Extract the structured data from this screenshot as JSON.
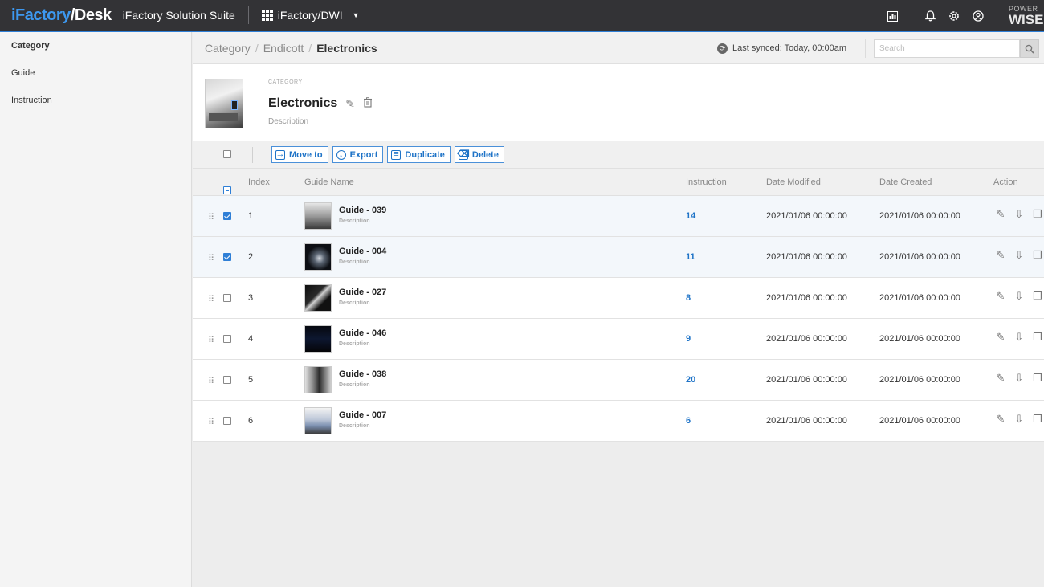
{
  "topbar": {
    "logo_part1": "iFactory",
    "logo_part2": "/Desk",
    "suite": "iFactory Solution Suite",
    "app_switcher": "iFactory/DWI",
    "brand_line1": "POWER",
    "brand_line2": "WISE",
    "icons": [
      "report-icon",
      "bell-icon",
      "gear-icon",
      "user-icon"
    ]
  },
  "sidebar": {
    "items": [
      {
        "label": "Category",
        "active": true
      },
      {
        "label": "Guide",
        "active": false
      },
      {
        "label": "Instruction",
        "active": false
      }
    ]
  },
  "breadcrumb": {
    "items": [
      "Category",
      "Endicott",
      "Electronics"
    ],
    "separator": "/"
  },
  "sync": {
    "text": "Last synced: Today, 00:00am"
  },
  "search": {
    "placeholder": "Search"
  },
  "category": {
    "label": "CATEGORY",
    "title": "Electronics",
    "description": "Description"
  },
  "toolbar": {
    "move_label": "Move to",
    "export_label": "Export",
    "duplicate_label": "Duplicate",
    "delete_label": "Delete"
  },
  "table": {
    "columns": {
      "index": "Index",
      "name": "Guide Name",
      "instruction": "Instruction",
      "modified": "Date Modified",
      "created": "Date Created",
      "action": "Action"
    },
    "rows": [
      {
        "index": "1",
        "name": "Guide - 039",
        "desc": "Description",
        "instruction": "14",
        "modified": "2021/01/06 00:00:00",
        "created": "2021/01/06 00:00:00",
        "checked": true
      },
      {
        "index": "2",
        "name": "Guide - 004",
        "desc": "Description",
        "instruction": "11",
        "modified": "2021/01/06 00:00:00",
        "created": "2021/01/06 00:00:00",
        "checked": true
      },
      {
        "index": "3",
        "name": "Guide - 027",
        "desc": "Description",
        "instruction": "8",
        "modified": "2021/01/06 00:00:00",
        "created": "2021/01/06 00:00:00",
        "checked": false
      },
      {
        "index": "4",
        "name": "Guide - 046",
        "desc": "Description",
        "instruction": "9",
        "modified": "2021/01/06 00:00:00",
        "created": "2021/01/06 00:00:00",
        "checked": false
      },
      {
        "index": "5",
        "name": "Guide - 038",
        "desc": "Description",
        "instruction": "20",
        "modified": "2021/01/06 00:00:00",
        "created": "2021/01/06 00:00:00",
        "checked": false
      },
      {
        "index": "6",
        "name": "Guide - 007",
        "desc": "Description",
        "instruction": "6",
        "modified": "2021/01/06 00:00:00",
        "created": "2021/01/06 00:00:00",
        "checked": false
      }
    ]
  },
  "colors": {
    "accent": "#2f7fd6",
    "topbar_bg": "#333336",
    "link": "#1e73c7"
  }
}
